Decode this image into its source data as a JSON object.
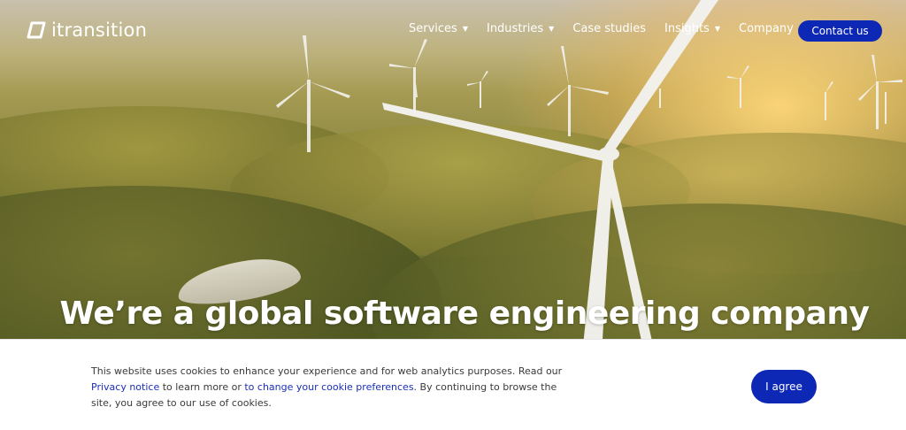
{
  "brand": {
    "name": "itransition"
  },
  "nav": {
    "items": [
      {
        "label": "Services",
        "has_dropdown": true
      },
      {
        "label": "Industries",
        "has_dropdown": true
      },
      {
        "label": "Case studies",
        "has_dropdown": false
      },
      {
        "label": "Insights",
        "has_dropdown": true
      },
      {
        "label": "Company",
        "has_dropdown": true
      }
    ],
    "contact_label": "Contact us"
  },
  "hero": {
    "headline": "We’re a global software engineering company"
  },
  "cookie": {
    "text_before_privacy": "This website uses cookies to enhance your experience and for web analytics purposes. Read our ",
    "privacy_link": "Privacy notice",
    "text_middle": " to learn more or ",
    "preferences_link": "to change your cookie preferences",
    "text_after": ". By continuing to browse the site, you agree to our use of cookies.",
    "agree_label": "I agree"
  },
  "colors": {
    "accent": "#0d28b5",
    "link": "#1a2fb8",
    "banner_bg": "#ffffff"
  },
  "icons": {
    "logo": "itransition-logo-mark",
    "caret": "caret-down-icon"
  }
}
